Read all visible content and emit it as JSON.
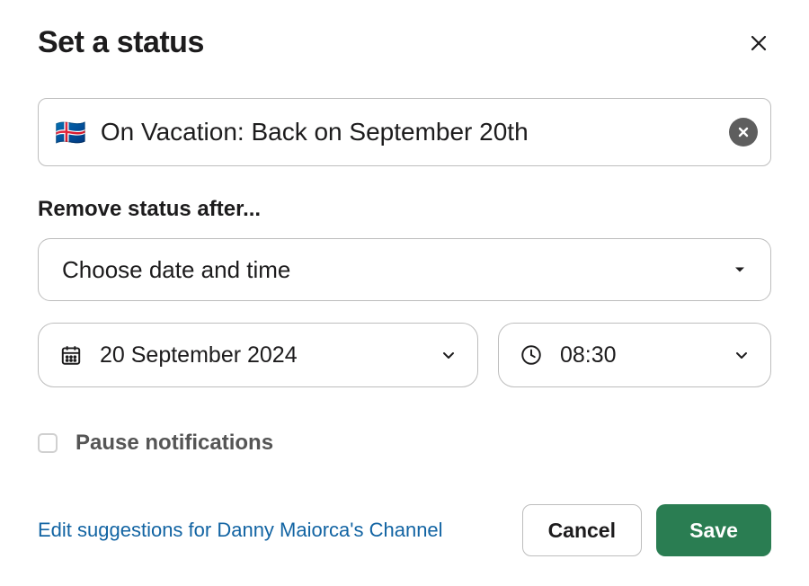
{
  "header": {
    "title": "Set a status"
  },
  "status": {
    "emoji": "🇮🇸",
    "text": "On Vacation: Back on September 20th"
  },
  "remove_after": {
    "label": "Remove status after...",
    "select_placeholder": "Choose date and time",
    "date": "20 September 2024",
    "time": "08:30"
  },
  "pause_notifications": {
    "label": "Pause notifications",
    "checked": false
  },
  "footer": {
    "link": "Edit suggestions for Danny Maiorca's Channel",
    "cancel": "Cancel",
    "save": "Save"
  }
}
